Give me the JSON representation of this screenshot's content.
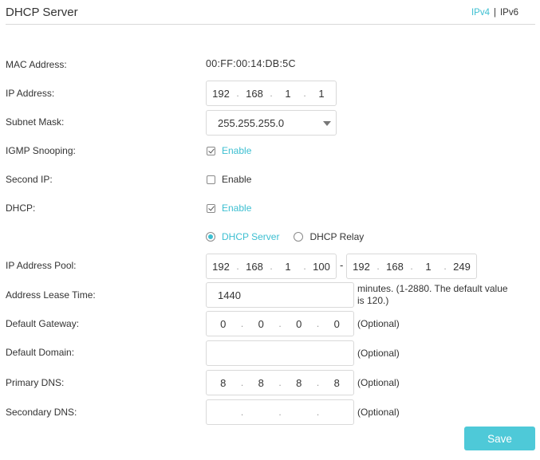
{
  "header": {
    "title": "DHCP Server",
    "ipv4_label": "IPv4",
    "separator": "|",
    "ipv6_label": "IPv6"
  },
  "fields": {
    "mac_address": {
      "label": "MAC Address:",
      "value": "00:FF:00:14:DB:5C"
    },
    "ip_address": {
      "label": "IP Address:",
      "octets": [
        "192",
        "168",
        "1",
        "1"
      ]
    },
    "subnet_mask": {
      "label": "Subnet Mask:",
      "value": "255.255.255.0"
    },
    "igmp_snooping": {
      "label": "IGMP Snooping:",
      "option": "Enable",
      "checked": true
    },
    "second_ip": {
      "label": "Second IP:",
      "option": "Enable",
      "checked": false
    },
    "dhcp": {
      "label": "DHCP:",
      "option": "Enable",
      "checked": true
    },
    "dhcp_mode": {
      "options": [
        "DHCP Server",
        "DHCP Relay"
      ],
      "selected": "DHCP Server"
    },
    "ip_pool": {
      "label": "IP Address Pool:",
      "start": [
        "192",
        "168",
        "1",
        "100"
      ],
      "dash": "-",
      "end": [
        "192",
        "168",
        "1",
        "249"
      ]
    },
    "lease_time": {
      "label": "Address Lease Time:",
      "value": "1440",
      "note": "minutes. (1-2880. The default value is 120.)"
    },
    "default_gateway": {
      "label": "Default Gateway:",
      "octets": [
        "0",
        "0",
        "0",
        "0"
      ],
      "suffix": "(Optional)"
    },
    "default_domain": {
      "label": "Default Domain:",
      "value": "",
      "suffix": "(Optional)"
    },
    "primary_dns": {
      "label": "Primary DNS:",
      "octets": [
        "8",
        "8",
        "8",
        "8"
      ],
      "suffix": "(Optional)"
    },
    "secondary_dns": {
      "label": "Secondary DNS:",
      "octets": [
        "",
        "",
        "",
        ""
      ],
      "suffix": "(Optional)"
    }
  },
  "actions": {
    "save_label": "Save"
  },
  "colors": {
    "accent": "#3cbfd1",
    "save_button": "#4ec9d8",
    "border": "#d9d9d9"
  }
}
